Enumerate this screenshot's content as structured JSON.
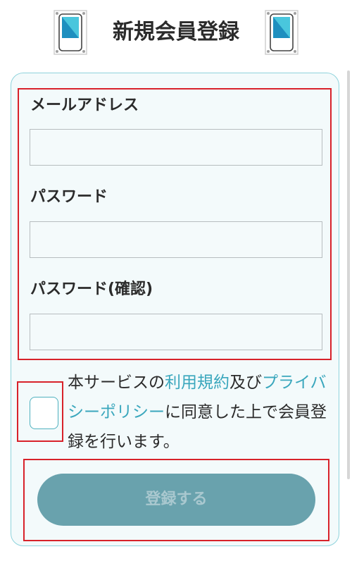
{
  "header": {
    "title": "新規会員登録",
    "left_icon": "card-icon",
    "right_icon": "card-icon"
  },
  "form": {
    "email_label": "メールアドレス",
    "email_value": "",
    "password_label": "パスワード",
    "password_value": "",
    "confirm_label": "パスワード(確認)",
    "confirm_value": ""
  },
  "agreement": {
    "prefix": "本サービスの",
    "terms_link": "利用規約",
    "and": "及び",
    "privacy_link": "プライバシーポリシー",
    "suffix": "に同意した上で会員登録を行います。",
    "checked": false
  },
  "submit": {
    "label": "登録する"
  },
  "colors": {
    "accent": "#3aa7bd",
    "button": "#69a2ad",
    "highlight_outline": "#d8222a",
    "panel_border": "#8fd3dc"
  }
}
